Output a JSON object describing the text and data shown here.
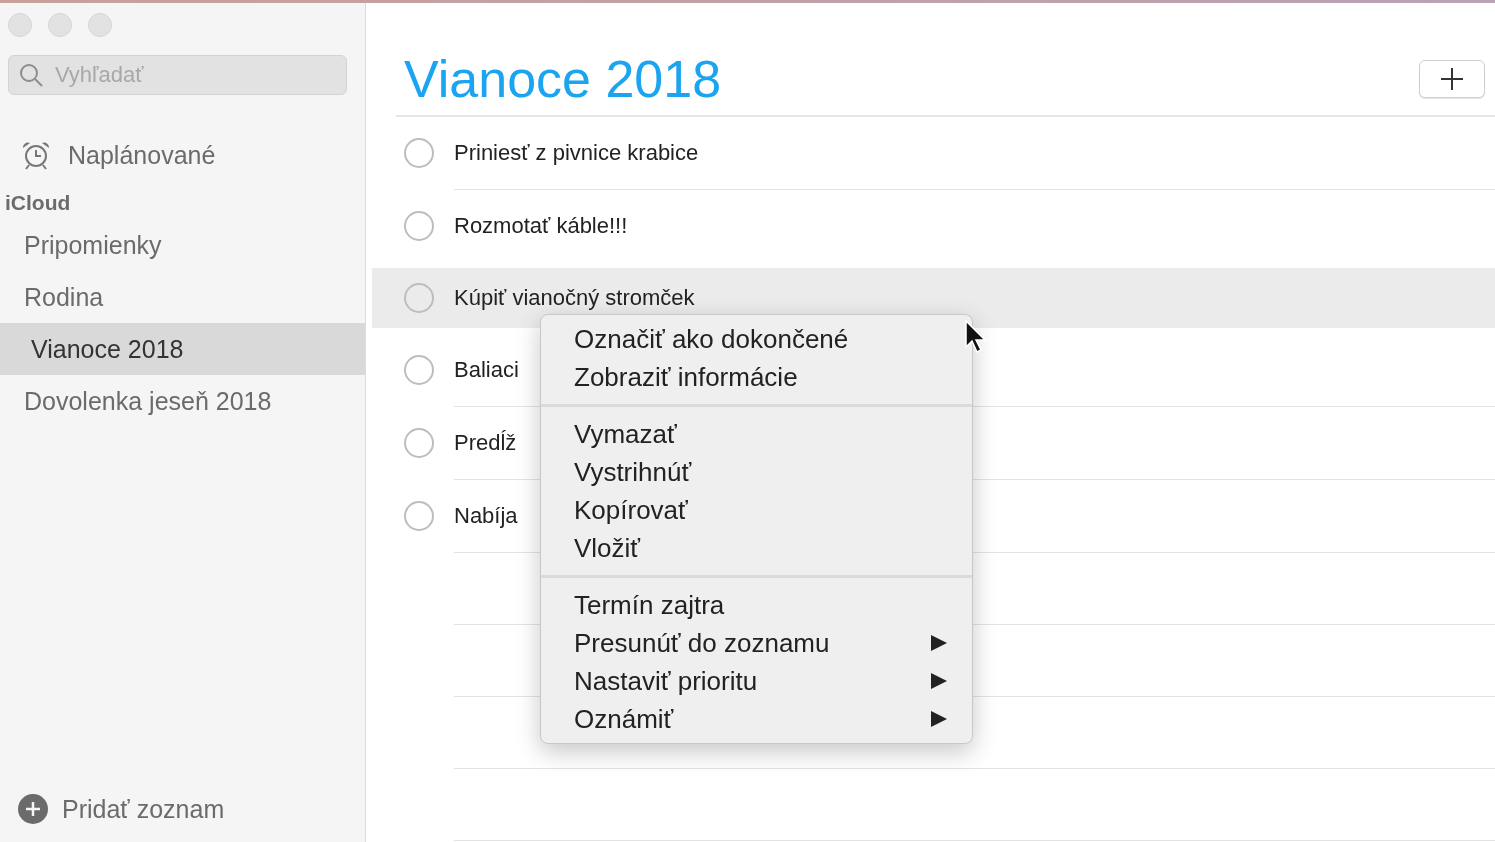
{
  "sidebar": {
    "search": {
      "placeholder": "Vyhľadať"
    },
    "scheduled": {
      "label": "Naplánované",
      "selected": false
    },
    "section": "iCloud",
    "lists": [
      {
        "label": "Pripomienky",
        "selected": false
      },
      {
        "label": "Rodina",
        "selected": false
      },
      {
        "label": "Vianoce 2018",
        "selected": true
      },
      {
        "label": "Dovolenka jeseň 2018",
        "selected": false
      }
    ],
    "add_list": "Pridať zoznam"
  },
  "main": {
    "title": "Vianoce 2018",
    "reminders": [
      {
        "text": "Priniesť z pivnice krabice",
        "checked": false,
        "selected": false
      },
      {
        "text": "Rozmotať káble!!!",
        "checked": false,
        "selected": false
      },
      {
        "text": "Kúpiť vianočný stromček",
        "checked": false,
        "selected": true
      },
      {
        "text": "Baliaci",
        "checked": false,
        "selected": false
      },
      {
        "text": "Predĺž",
        "checked": false,
        "selected": false
      },
      {
        "text": "Nabíja",
        "checked": false,
        "selected": false
      }
    ]
  },
  "context_menu": {
    "sections": [
      [
        {
          "label": "Označiť ako dokončené",
          "submenu": false
        },
        {
          "label": "Zobraziť informácie",
          "submenu": false
        }
      ],
      [
        {
          "label": "Vymazať",
          "submenu": false
        },
        {
          "label": "Vystrihnúť",
          "submenu": false
        },
        {
          "label": "Kopírovať",
          "submenu": false
        },
        {
          "label": "Vložiť",
          "submenu": false
        }
      ],
      [
        {
          "label": "Termín zajtra",
          "submenu": false
        },
        {
          "label": "Presunúť do zoznamu",
          "submenu": true
        },
        {
          "label": "Nastaviť prioritu",
          "submenu": true
        },
        {
          "label": "Oznámiť",
          "submenu": true
        }
      ]
    ]
  }
}
